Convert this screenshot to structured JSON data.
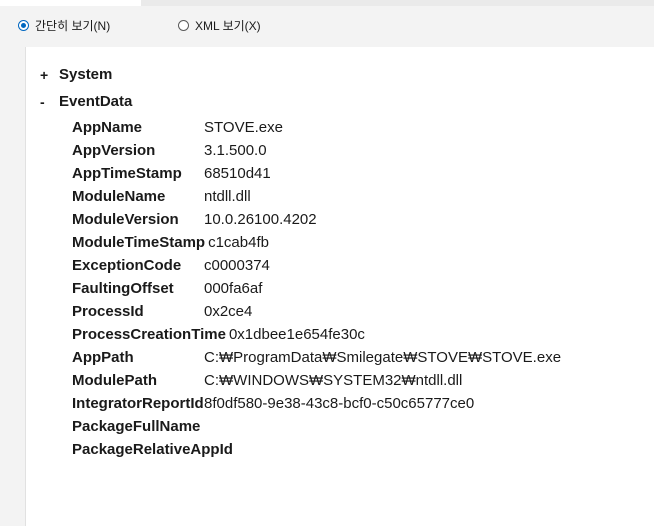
{
  "view_options": {
    "simple": "간단히 보기(N)",
    "xml": "XML 보기(X)",
    "selected": "simple"
  },
  "tree": {
    "system": {
      "toggle": "+",
      "label": "System"
    },
    "eventdata": {
      "toggle": "-",
      "label": "EventData"
    }
  },
  "fields": [
    {
      "key": "AppName",
      "value": "STOVE.exe"
    },
    {
      "key": "AppVersion",
      "value": "3.1.500.0"
    },
    {
      "key": "AppTimeStamp",
      "value": "68510d41"
    },
    {
      "key": "ModuleName",
      "value": "ntdll.dll"
    },
    {
      "key": "ModuleVersion",
      "value": "10.0.26100.4202"
    },
    {
      "key": "ModuleTimeStamp",
      "value": "c1cab4fb"
    },
    {
      "key": "ExceptionCode",
      "value": "c0000374"
    },
    {
      "key": "FaultingOffset",
      "value": "000fa6af"
    },
    {
      "key": "ProcessId",
      "value": "0x2ce4"
    },
    {
      "key": "ProcessCreationTime",
      "value": "0x1dbee1e654fe30c"
    },
    {
      "key": "AppPath",
      "value": "C:₩ProgramData₩Smilegate₩STOVE₩STOVE.exe"
    },
    {
      "key": "ModulePath",
      "value": "C:₩WINDOWS₩SYSTEM32₩ntdll.dll"
    },
    {
      "key": "IntegratorReportId",
      "value": "8f0df580-9e38-43c8-bcf0-c50c65777ce0"
    },
    {
      "key": "PackageFullName",
      "value": ""
    },
    {
      "key": "PackageRelativeAppId",
      "value": ""
    }
  ]
}
